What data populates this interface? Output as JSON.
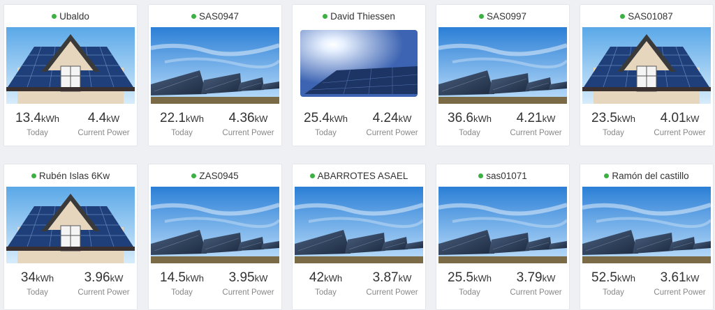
{
  "stations": [
    {
      "name": "Ubaldo",
      "energy": "13.4",
      "energy_unit": "kWh",
      "power": "4.4",
      "power_unit": "kW",
      "today_label": "Today",
      "power_label": "Current Power",
      "image": "house",
      "status_color": "#3cb043"
    },
    {
      "name": "SAS0947",
      "energy": "22.1",
      "energy_unit": "kWh",
      "power": "4.36",
      "power_unit": "kW",
      "today_label": "Today",
      "power_label": "Current Power",
      "image": "field",
      "status_color": "#3cb043"
    },
    {
      "name": "David Thiessen",
      "energy": "25.4",
      "energy_unit": "kWh",
      "power": "4.24",
      "power_unit": "kW",
      "today_label": "Today",
      "power_label": "Current Power",
      "image": "sun",
      "status_color": "#3cb043"
    },
    {
      "name": "SAS0997",
      "energy": "36.6",
      "energy_unit": "kWh",
      "power": "4.21",
      "power_unit": "kW",
      "today_label": "Today",
      "power_label": "Current Power",
      "image": "field",
      "status_color": "#3cb043"
    },
    {
      "name": "SAS01087",
      "energy": "23.5",
      "energy_unit": "kWh",
      "power": "4.01",
      "power_unit": "kW",
      "today_label": "Today",
      "power_label": "Current Power",
      "image": "house",
      "status_color": "#3cb043"
    },
    {
      "name": "Rubén Islas 6Kw",
      "energy": "34",
      "energy_unit": "kWh",
      "power": "3.96",
      "power_unit": "kW",
      "today_label": "Today",
      "power_label": "Current Power",
      "image": "house",
      "status_color": "#3cb043"
    },
    {
      "name": "ZAS0945",
      "energy": "14.5",
      "energy_unit": "kWh",
      "power": "3.95",
      "power_unit": "kW",
      "today_label": "Today",
      "power_label": "Current Power",
      "image": "field",
      "status_color": "#3cb043"
    },
    {
      "name": "ABARROTES ASAEL",
      "energy": "42",
      "energy_unit": "kWh",
      "power": "3.87",
      "power_unit": "kW",
      "today_label": "Today",
      "power_label": "Current Power",
      "image": "field",
      "status_color": "#3cb043"
    },
    {
      "name": "sas01071",
      "energy": "25.5",
      "energy_unit": "kWh",
      "power": "3.79",
      "power_unit": "kW",
      "today_label": "Today",
      "power_label": "Current Power",
      "image": "field",
      "status_color": "#3cb043"
    },
    {
      "name": "Ramón del castillo",
      "energy": "52.5",
      "energy_unit": "kWh",
      "power": "3.61",
      "power_unit": "kW",
      "today_label": "Today",
      "power_label": "Current Power",
      "image": "field",
      "status_color": "#3cb043"
    }
  ]
}
